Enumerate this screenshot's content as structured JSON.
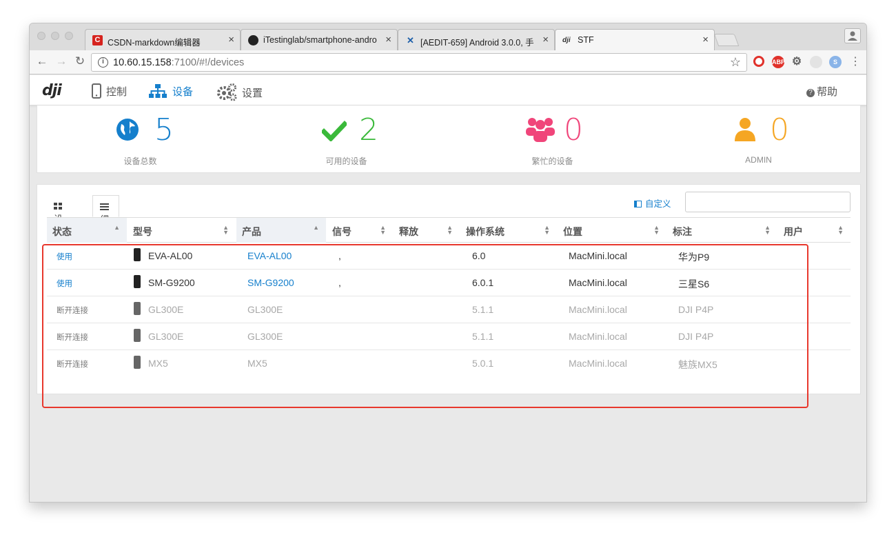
{
  "browser": {
    "tabs": [
      {
        "title": "CSDN-markdown编辑器",
        "favicon": "csdn-icon"
      },
      {
        "title": "iTestinglab/smartphone-andro",
        "favicon": "github-icon"
      },
      {
        "title": "[AEDIT-659] Android 3.0.0, 手",
        "favicon": "jira-icon"
      },
      {
        "title": "STF",
        "favicon": "dji-icon"
      }
    ],
    "url_host": "10.60.15.158",
    "url_rest": ":7100/#!/devices"
  },
  "app": {
    "logo": "dji",
    "nav": {
      "control": "控制",
      "devices": "设备",
      "settings": "设置"
    },
    "help": "帮助"
  },
  "stats": [
    {
      "value": "5",
      "label": "设备总数",
      "color": "#157fcc",
      "icon": "globe-icon"
    },
    {
      "value": "2",
      "label": "可用的设备",
      "color": "#3ab93a",
      "icon": "check-icon"
    },
    {
      "value": "0",
      "label": "繁忙的设备",
      "color": "#f0457a",
      "icon": "users-icon"
    },
    {
      "value": "0",
      "label": "ADMIN",
      "color": "#f5a623",
      "icon": "user-icon"
    }
  ],
  "panel": {
    "tab_devices": "设备",
    "tab_details": "细节",
    "customize": "自定义",
    "search_placeholder": ""
  },
  "table": {
    "columns": [
      "状态",
      "型号",
      "产品",
      "信号",
      "释放",
      "操作系统",
      "位置",
      "标注",
      "用户"
    ],
    "rows": [
      {
        "status": "使用",
        "model": "EVA-AL00",
        "product": "EVA-AL00",
        "signal": ",",
        "release": "",
        "os": "6.0",
        "location": "MacMini.local",
        "note": "华为P9",
        "user": ""
      },
      {
        "status": "使用",
        "model": "SM-G9200",
        "product": "SM-G9200",
        "signal": ",",
        "release": "",
        "os": "6.0.1",
        "location": "MacMini.local",
        "note": "三星S6",
        "user": ""
      },
      {
        "status": "断开连接",
        "model": "GL300E",
        "product": "GL300E",
        "signal": "",
        "release": "",
        "os": "5.1.1",
        "location": "MacMini.local",
        "note": "DJI P4P",
        "user": ""
      },
      {
        "status": "断开连接",
        "model": "GL300E",
        "product": "GL300E",
        "signal": "",
        "release": "",
        "os": "5.1.1",
        "location": "MacMini.local",
        "note": "DJI P4P",
        "user": ""
      },
      {
        "status": "断开连接",
        "model": "MX5",
        "product": "MX5",
        "signal": "",
        "release": "",
        "os": "5.0.1",
        "location": "MacMini.local",
        "note": "魅族MX5",
        "user": ""
      }
    ]
  },
  "colors": {
    "accent": "#157fcc",
    "highlight_border": "#e8372c"
  }
}
